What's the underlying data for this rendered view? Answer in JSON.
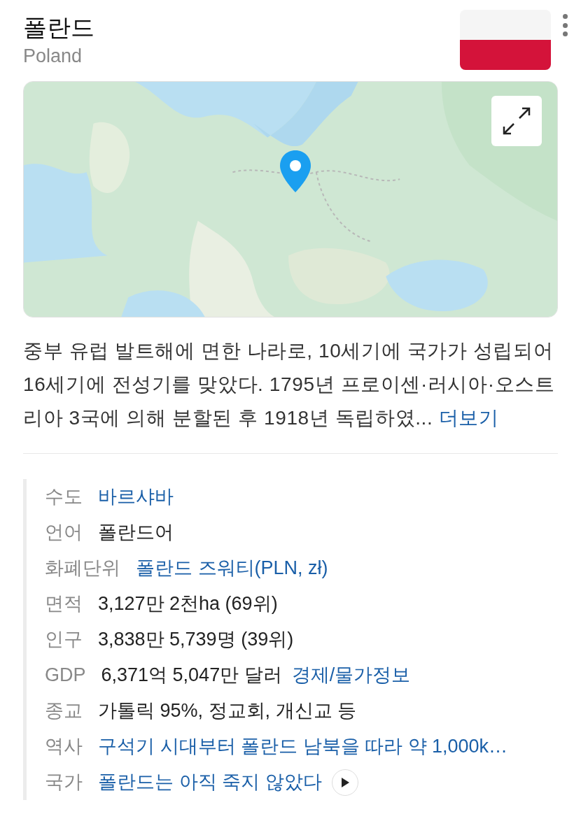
{
  "header": {
    "title": "폴란드",
    "subtitle": "Poland"
  },
  "description": {
    "text": "중부 유럽 발트해에 면한 나라로, 10세기에 국가가 성립되어 16세기에 전성기를 맞았다. 1795년 프로이센·러시아·오스트리아 3국에 의해 분할된 후 1918년 독립하였...",
    "more": "더보기"
  },
  "facts": [
    {
      "label": "수도",
      "parts": [
        {
          "kind": "link",
          "text": "바르샤바"
        }
      ]
    },
    {
      "label": "언어",
      "parts": [
        {
          "kind": "text",
          "text": "폴란드어"
        }
      ]
    },
    {
      "label": "화폐단위",
      "parts": [
        {
          "kind": "link",
          "text": "폴란드 즈워티(PLN, zł)"
        }
      ]
    },
    {
      "label": "면적",
      "parts": [
        {
          "kind": "text",
          "text": "3,127만 2천ha (69위)"
        }
      ]
    },
    {
      "label": "인구",
      "parts": [
        {
          "kind": "text",
          "text": "3,838만 5,739명 (39위)"
        }
      ]
    },
    {
      "label": "GDP",
      "parts": [
        {
          "kind": "text",
          "text": "6,371억 5,047만 달러"
        },
        {
          "kind": "link",
          "text": "경제/물가정보"
        }
      ]
    },
    {
      "label": "종교",
      "parts": [
        {
          "kind": "text",
          "text": "가톨릭 95%, 정교회, 개신교 등"
        }
      ]
    },
    {
      "label": "역사",
      "parts": [
        {
          "kind": "link",
          "text": "구석기 시대부터 폴란드 남북을 따라 약 1,000k…"
        }
      ]
    },
    {
      "label": "국가",
      "parts": [
        {
          "kind": "link",
          "text": "폴란드는 아직 죽지 않았다"
        },
        {
          "kind": "play"
        }
      ]
    }
  ]
}
